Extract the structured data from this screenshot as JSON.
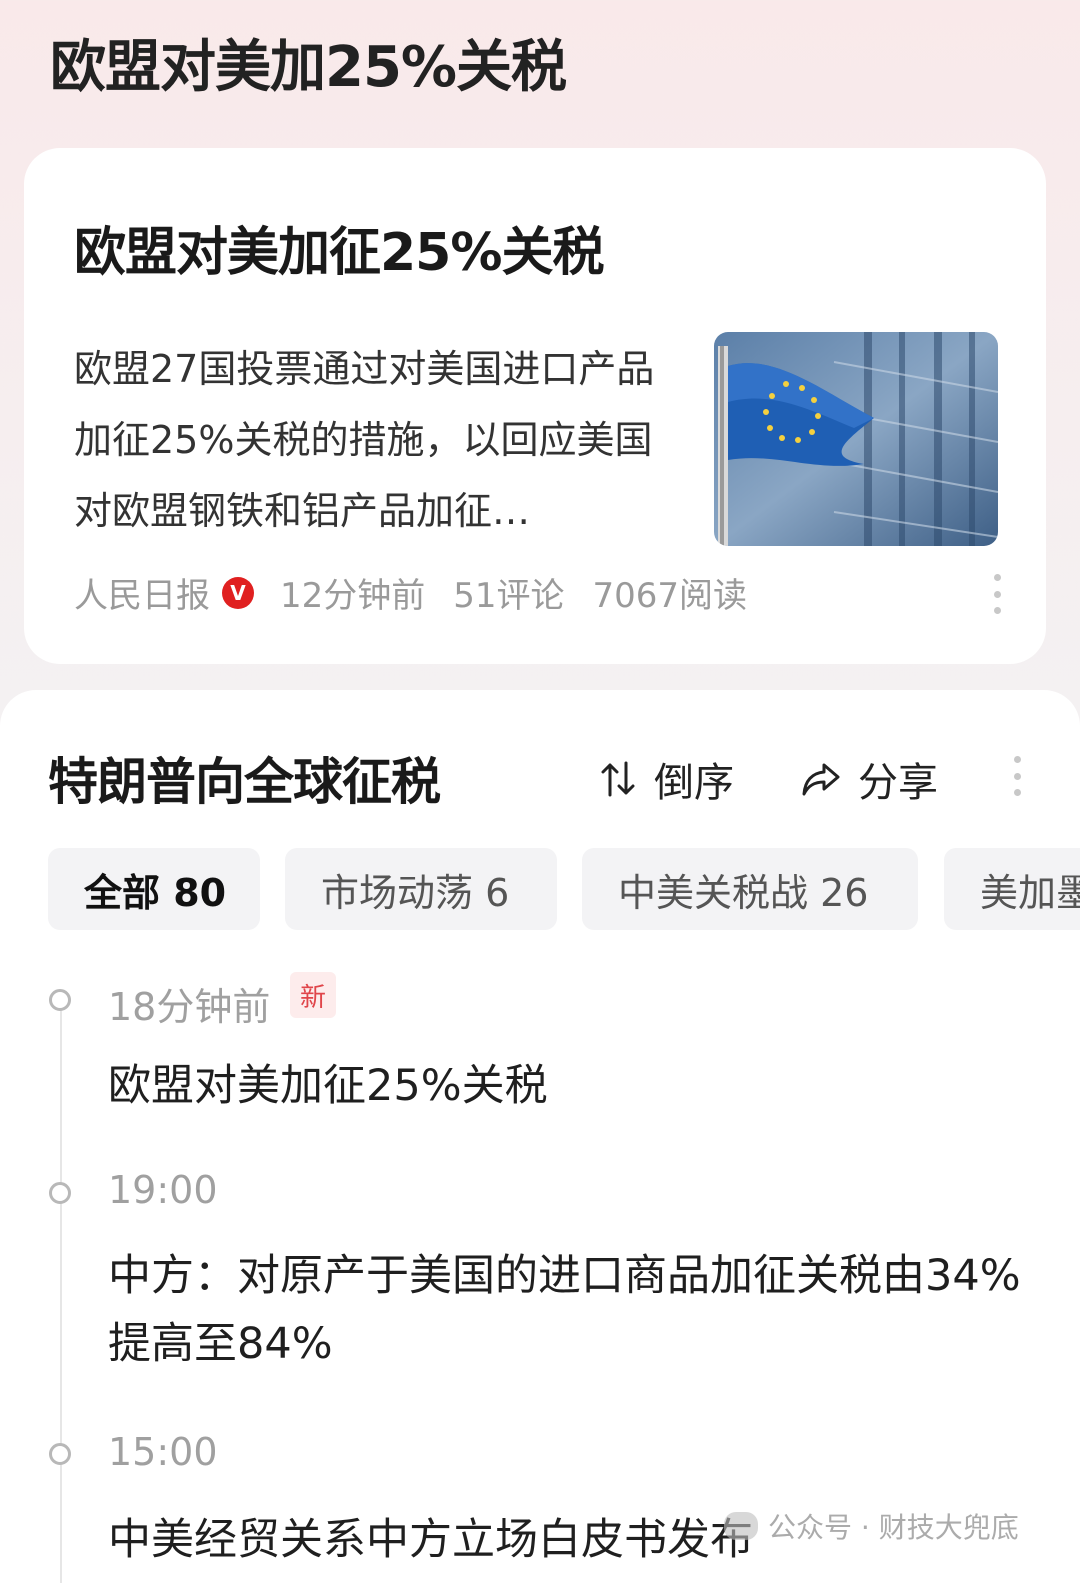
{
  "header": {
    "title": "欧盟对美加25%关税"
  },
  "card": {
    "title": "欧盟对美加征25%关税",
    "summary": "欧盟27国投票通过对美国进口产品加征25%关税的措施，以回应美国对欧盟钢铁和铝产品加征…",
    "source": "人民日报",
    "verified_mark": "V",
    "time": "12分钟前",
    "comments": "51评论",
    "reads": "7067阅读",
    "image_icon": "eu-flag-image"
  },
  "topic": {
    "title": "特朗普向全球征税",
    "sort_label": "倒序",
    "share_label": "分享"
  },
  "tabs": [
    {
      "label": "全部 80",
      "active": true
    },
    {
      "label": "市场动荡 6",
      "active": false
    },
    {
      "label": "中美关税战 26",
      "active": false
    },
    {
      "label": "美加墨",
      "active": false
    }
  ],
  "timeline": [
    {
      "time": "18分钟前",
      "badge": "新",
      "text": "欧盟对美加征25%关税"
    },
    {
      "time": "19:00",
      "badge": "",
      "text": "中方：对原产于美国的进口商品加征关税由34%提高至84%"
    },
    {
      "time": "15:00",
      "badge": "",
      "text": "中美经贸关系中方立场白皮书发布"
    }
  ],
  "watermark": {
    "text": "公众号 · 财技大兜底"
  },
  "colors": {
    "badge_red": "#e02020",
    "new_badge_text": "#e0454a"
  }
}
